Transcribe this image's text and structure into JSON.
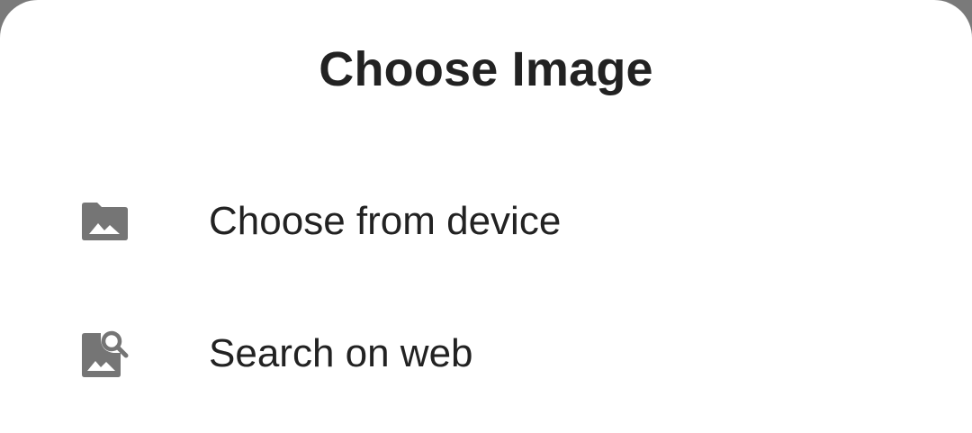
{
  "dialog": {
    "title": "Choose Image",
    "options": [
      {
        "label": "Choose from device",
        "icon": "folder-image-icon"
      },
      {
        "label": "Search on web",
        "icon": "image-search-icon"
      }
    ]
  },
  "colors": {
    "scrim": "#7a7a7a",
    "surface": "#ffffff",
    "text": "#222222",
    "icon": "#757575"
  }
}
